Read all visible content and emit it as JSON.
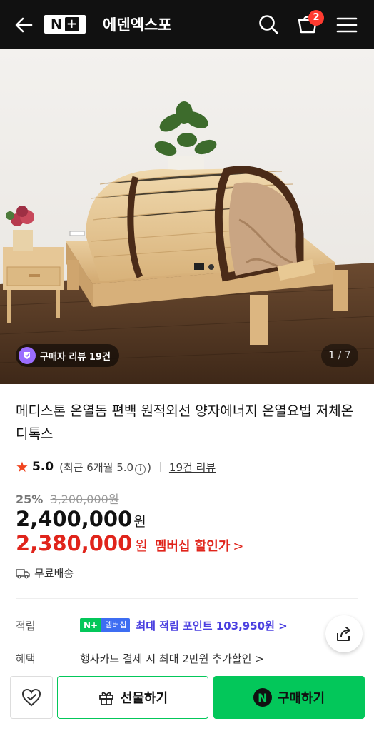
{
  "header": {
    "brand_logo": "N+",
    "store_name": "에덴엑스포",
    "cart_count": "2",
    "icons": {
      "back": "arrow-left-icon",
      "search": "search-icon",
      "cart": "cart-icon",
      "menu": "hamburger-menu-icon"
    }
  },
  "gallery": {
    "review_chip": "구매자 리뷰 19건",
    "page_current": "1",
    "page_total": "/ 7"
  },
  "product": {
    "title": "메디스톤 온열돔 편백 원적외선 양자에너지 온열요법 저체온 디톡스",
    "rating": {
      "score": "5.0",
      "recent_prefix": "(최근 6개월 5.0",
      "recent_suffix": ")",
      "info_symbol": "i",
      "review_link": "19건 리뷰"
    },
    "discount_rate": "25%",
    "original_price": "3,200,000원",
    "price": "2,400,000",
    "price_unit": "원",
    "member_price": "2,380,000",
    "member_price_unit": "원",
    "member_label": "멤버십 할인가",
    "member_chevron": ">",
    "shipping": "무료배송"
  },
  "benefits": {
    "points_label": "적립",
    "np_badge": "N+",
    "np_badge_member": "멤버십",
    "points_text": "최대 적립 포인트 103,950원 >",
    "benefit_label": "혜택",
    "benefit_text": "행사카드 결제 시 최대 2만원 추가할인 >"
  },
  "bottom_bar": {
    "gift_label": "선물하기",
    "buy_label": "구매하기",
    "buy_icon_letter": "N"
  },
  "colors": {
    "header_bg": "#111111",
    "naver_green": "#03c75a",
    "price_red": "#e0241b",
    "point_purple": "#4a3fe0",
    "star": "#f0441f"
  }
}
